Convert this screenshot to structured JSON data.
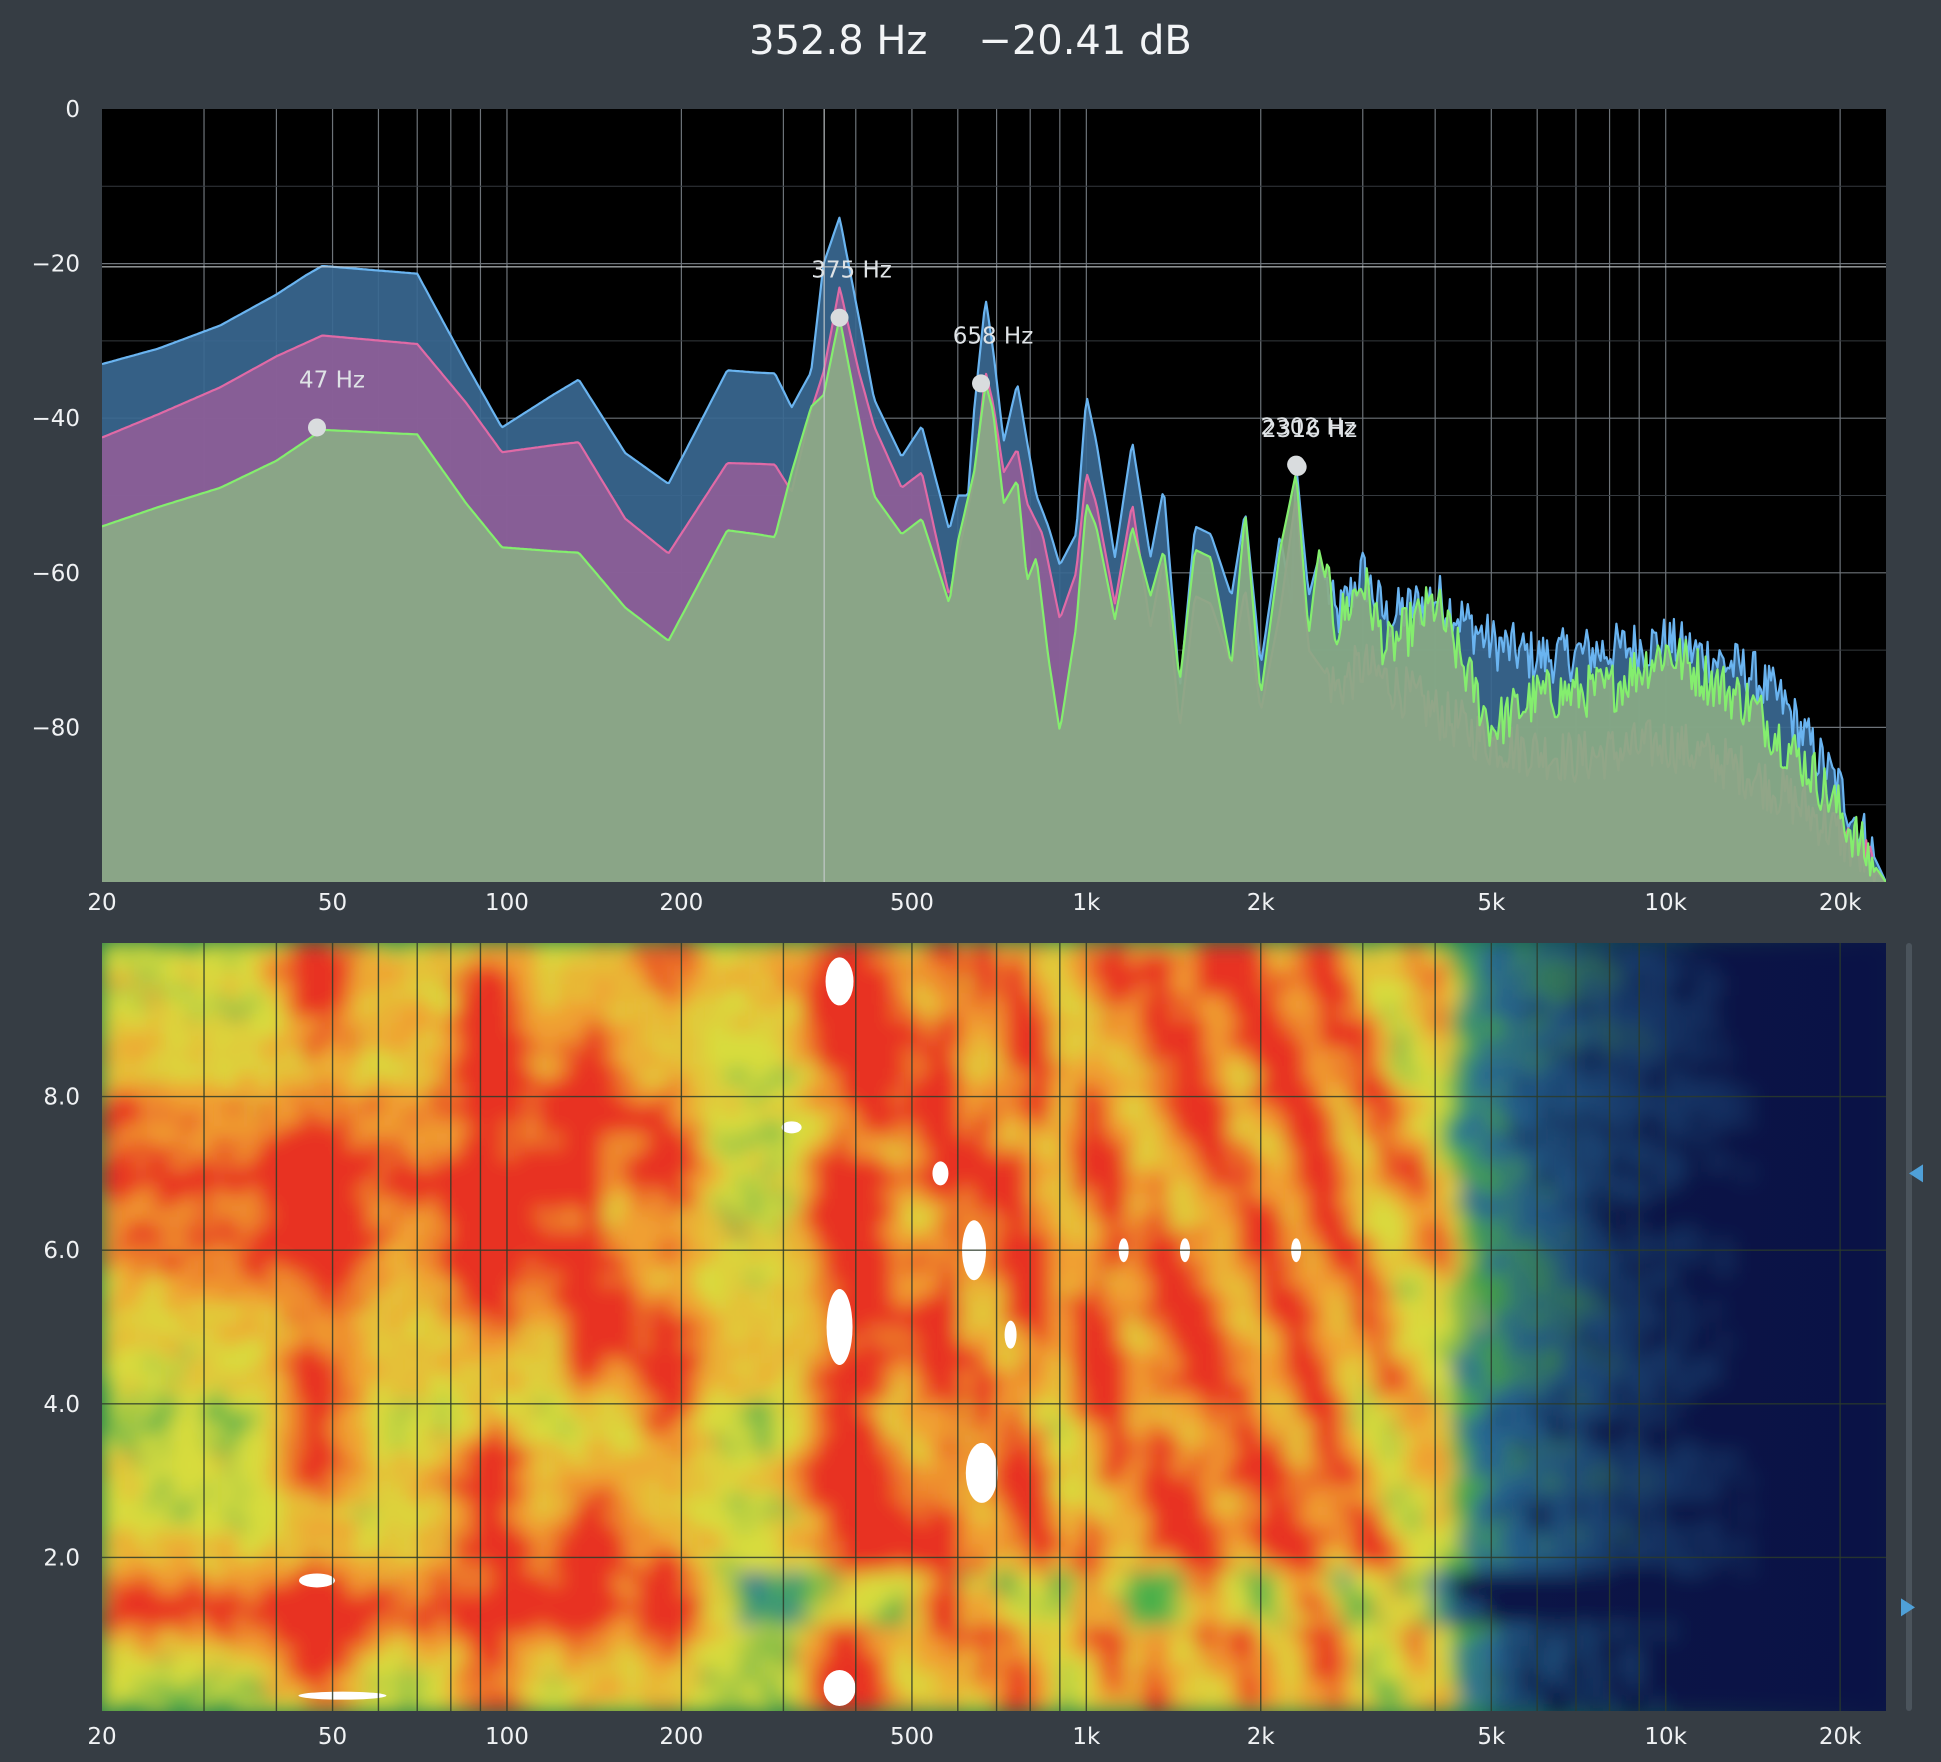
{
  "readout": {
    "frequency": "352.8 Hz",
    "level": "−20.41 dB"
  },
  "colors": {
    "background": "#363d44",
    "plot_bg": "#000000",
    "blue": "#5fa7e8",
    "pink": "#d9679c",
    "green": "#7de86a"
  },
  "chart_data": [
    {
      "type": "area",
      "title": "",
      "xscale": "log",
      "xlim": [
        20,
        24000
      ],
      "ylim": [
        -100,
        0
      ],
      "xticks": [
        {
          "v": 20,
          "t": "20"
        },
        {
          "v": 50,
          "t": "50"
        },
        {
          "v": 100,
          "t": "100"
        },
        {
          "v": 200,
          "t": "200"
        },
        {
          "v": 500,
          "t": "500"
        },
        {
          "v": 1000,
          "t": "1k"
        },
        {
          "v": 2000,
          "t": "2k"
        },
        {
          "v": 5000,
          "t": "5k"
        },
        {
          "v": 10000,
          "t": "10k"
        },
        {
          "v": 20000,
          "t": "20k"
        }
      ],
      "yticks": [
        {
          "v": 0,
          "t": "0"
        },
        {
          "v": -20,
          "t": "−20"
        },
        {
          "v": -40,
          "t": "−40"
        },
        {
          "v": -60,
          "t": "−60"
        },
        {
          "v": -80,
          "t": "−80"
        }
      ],
      "cursor": {
        "frequency": 352.8,
        "level": -20.41
      },
      "peaks": [
        {
          "label": "47 Hz",
          "f": 47,
          "db": -41.2
        },
        {
          "label": "375 Hz",
          "f": 375,
          "db": -27
        },
        {
          "label": "658 Hz",
          "f": 658,
          "db": -35.5
        },
        {
          "label": "2302 Hz",
          "f": 2302,
          "db": -46
        },
        {
          "label": "2316 Hz",
          "f": 2316,
          "db": -46.3
        }
      ],
      "series": [
        {
          "color": "#5fa7e8",
          "points": [
            [
              20,
              -33
            ],
            [
              25,
              -31
            ],
            [
              32,
              -28
            ],
            [
              40,
              -24
            ],
            [
              45,
              -21.5
            ],
            [
              48,
              -20.3
            ],
            [
              70,
              -21.3
            ],
            [
              85,
              -33
            ],
            [
              98,
              -41.2
            ],
            [
              120,
              -37
            ],
            [
              133,
              -35
            ],
            [
              160,
              -44.5
            ],
            [
              190,
              -48.5
            ],
            [
              240,
              -33.8
            ],
            [
              270,
              -34.1
            ],
            [
              290,
              -34.2
            ],
            [
              310,
              -38.6
            ],
            [
              335,
              -34
            ],
            [
              352,
              -20
            ],
            [
              375,
              -14
            ],
            [
              405,
              -27
            ],
            [
              430,
              -37.5
            ],
            [
              480,
              -45
            ],
            [
              520,
              -41
            ],
            [
              580,
              -54.5
            ],
            [
              600,
              -50
            ],
            [
              625,
              -50
            ],
            [
              640,
              -39
            ],
            [
              670,
              -24.5
            ],
            [
              690,
              -31
            ],
            [
              720,
              -43
            ],
            [
              760,
              -35.5
            ],
            [
              790,
              -43
            ],
            [
              820,
              -50
            ],
            [
              860,
              -54
            ],
            [
              900,
              -59
            ],
            [
              960,
              -55
            ],
            [
              1000,
              -37
            ],
            [
              1040,
              -43
            ],
            [
              1120,
              -58
            ],
            [
              1200,
              -43
            ],
            [
              1290,
              -58
            ],
            [
              1360,
              -49
            ],
            [
              1450,
              -75
            ],
            [
              1540,
              -54
            ],
            [
              1640,
              -55
            ],
            [
              1780,
              -63
            ],
            [
              1880,
              -52
            ],
            [
              2000,
              -72
            ],
            [
              2160,
              -55
            ],
            [
              2260,
              -64
            ],
            [
              2302,
              -46
            ],
            [
              2420,
              -63
            ],
            [
              2520,
              -58
            ],
            [
              2700,
              -66
            ],
            [
              3000,
              -60
            ],
            [
              3300,
              -66
            ],
            [
              4000,
              -63
            ],
            [
              5000,
              -69
            ],
            [
              6000,
              -71
            ],
            [
              8000,
              -70
            ],
            [
              10000,
              -69
            ],
            [
              12000,
              -71
            ],
            [
              14000,
              -73
            ],
            [
              16000,
              -77
            ],
            [
              18000,
              -83
            ],
            [
              20000,
              -88
            ],
            [
              22000,
              -94
            ],
            [
              24000,
              -100
            ]
          ]
        },
        {
          "color": "#d9679c",
          "points": [
            [
              20,
              -42.5
            ],
            [
              25,
              -39.5
            ],
            [
              32,
              -36
            ],
            [
              40,
              -32
            ],
            [
              48,
              -29.3
            ],
            [
              70,
              -30.4
            ],
            [
              85,
              -38
            ],
            [
              98,
              -44.4
            ],
            [
              120,
              -43.5
            ],
            [
              133,
              -43.1
            ],
            [
              160,
              -53
            ],
            [
              190,
              -57.5
            ],
            [
              240,
              -45.8
            ],
            [
              270,
              -45.9
            ],
            [
              290,
              -46
            ],
            [
              310,
              -49.5
            ],
            [
              335,
              -39
            ],
            [
              352,
              -34
            ],
            [
              375,
              -23
            ],
            [
              405,
              -34
            ],
            [
              430,
              -41
            ],
            [
              480,
              -49
            ],
            [
              520,
              -47
            ],
            [
              580,
              -63
            ],
            [
              640,
              -48
            ],
            [
              670,
              -34
            ],
            [
              690,
              -38
            ],
            [
              720,
              -47
            ],
            [
              760,
              -44
            ],
            [
              790,
              -51
            ],
            [
              840,
              -55
            ],
            [
              900,
              -66
            ],
            [
              960,
              -60
            ],
            [
              1000,
              -47
            ],
            [
              1040,
              -51
            ],
            [
              1120,
              -64
            ],
            [
              1200,
              -51
            ],
            [
              1290,
              -67
            ],
            [
              1360,
              -58
            ],
            [
              1450,
              -80
            ],
            [
              1540,
              -63
            ],
            [
              1640,
              -64
            ],
            [
              1780,
              -72
            ],
            [
              1880,
              -62
            ],
            [
              2000,
              -78
            ],
            [
              2160,
              -65
            ],
            [
              2302,
              -50
            ],
            [
              2420,
              -70
            ],
            [
              2700,
              -75
            ],
            [
              3000,
              -72
            ],
            [
              4000,
              -78
            ],
            [
              5000,
              -82
            ],
            [
              7000,
              -84
            ],
            [
              10000,
              -82
            ],
            [
              12000,
              -84
            ],
            [
              14000,
              -86
            ],
            [
              17000,
              -90
            ],
            [
              20000,
              -94
            ],
            [
              24000,
              -100
            ]
          ]
        },
        {
          "color": "#7de86a",
          "points": [
            [
              20,
              -54
            ],
            [
              25,
              -51.5
            ],
            [
              32,
              -49
            ],
            [
              40,
              -45.5
            ],
            [
              48,
              -41.5
            ],
            [
              70,
              -42.1
            ],
            [
              85,
              -51
            ],
            [
              98,
              -56.7
            ],
            [
              120,
              -57.2
            ],
            [
              133,
              -57.4
            ],
            [
              160,
              -64.5
            ],
            [
              190,
              -68.8
            ],
            [
              240,
              -54.5
            ],
            [
              270,
              -55
            ],
            [
              290,
              -55.4
            ],
            [
              310,
              -47
            ],
            [
              335,
              -38.5
            ],
            [
              352,
              -37
            ],
            [
              375,
              -27
            ],
            [
              405,
              -40
            ],
            [
              430,
              -50
            ],
            [
              480,
              -55
            ],
            [
              520,
              -53
            ],
            [
              580,
              -64
            ],
            [
              600,
              -56
            ],
            [
              640,
              -47
            ],
            [
              670,
              -35.5
            ],
            [
              690,
              -39
            ],
            [
              720,
              -51
            ],
            [
              760,
              -48
            ],
            [
              790,
              -61
            ],
            [
              820,
              -58
            ],
            [
              860,
              -71
            ],
            [
              900,
              -80.5
            ],
            [
              960,
              -67
            ],
            [
              1000,
              -51
            ],
            [
              1040,
              -54
            ],
            [
              1120,
              -66
            ],
            [
              1200,
              -54
            ],
            [
              1290,
              -63
            ],
            [
              1360,
              -57
            ],
            [
              1450,
              -74
            ],
            [
              1540,
              -57
            ],
            [
              1640,
              -58
            ],
            [
              1780,
              -72
            ],
            [
              1880,
              -52
            ],
            [
              2000,
              -76
            ],
            [
              2160,
              -57
            ],
            [
              2302,
              -47
            ],
            [
              2420,
              -68
            ],
            [
              2520,
              -57
            ],
            [
              2700,
              -67
            ],
            [
              3000,
              -61
            ],
            [
              3300,
              -70
            ],
            [
              4000,
              -64
            ],
            [
              5000,
              -80
            ],
            [
              6000,
              -76
            ],
            [
              8000,
              -75
            ],
            [
              10000,
              -70
            ],
            [
              12000,
              -74
            ],
            [
              14000,
              -77
            ],
            [
              16000,
              -82
            ],
            [
              18000,
              -86
            ],
            [
              20000,
              -91
            ],
            [
              22000,
              -96
            ],
            [
              24000,
              -100
            ]
          ]
        }
      ]
    },
    {
      "type": "heatmap",
      "title": "",
      "xscale": "log",
      "xlim": [
        20,
        24000
      ],
      "ylim": [
        0,
        10
      ],
      "xticks": [
        {
          "v": 20,
          "t": "20"
        },
        {
          "v": 50,
          "t": "50"
        },
        {
          "v": 100,
          "t": "100"
        },
        {
          "v": 200,
          "t": "200"
        },
        {
          "v": 500,
          "t": "500"
        },
        {
          "v": 1000,
          "t": "1k"
        },
        {
          "v": 2000,
          "t": "2k"
        },
        {
          "v": 5000,
          "t": "5k"
        },
        {
          "v": 10000,
          "t": "10k"
        },
        {
          "v": 20000,
          "t": "20k"
        }
      ],
      "yticks": [
        {
          "v": 2,
          "t": "2.0"
        },
        {
          "v": 4,
          "t": "4.0"
        },
        {
          "v": 6,
          "t": "6.0"
        },
        {
          "v": 8,
          "t": "8.0"
        }
      ],
      "colormap": [
        "#0a1246",
        "#2a6f9a",
        "#4cb04a",
        "#d8dc3c",
        "#f0a030",
        "#e83020",
        "#ffffff"
      ],
      "scroll_markers": [
        7.0,
        1.35
      ]
    }
  ]
}
